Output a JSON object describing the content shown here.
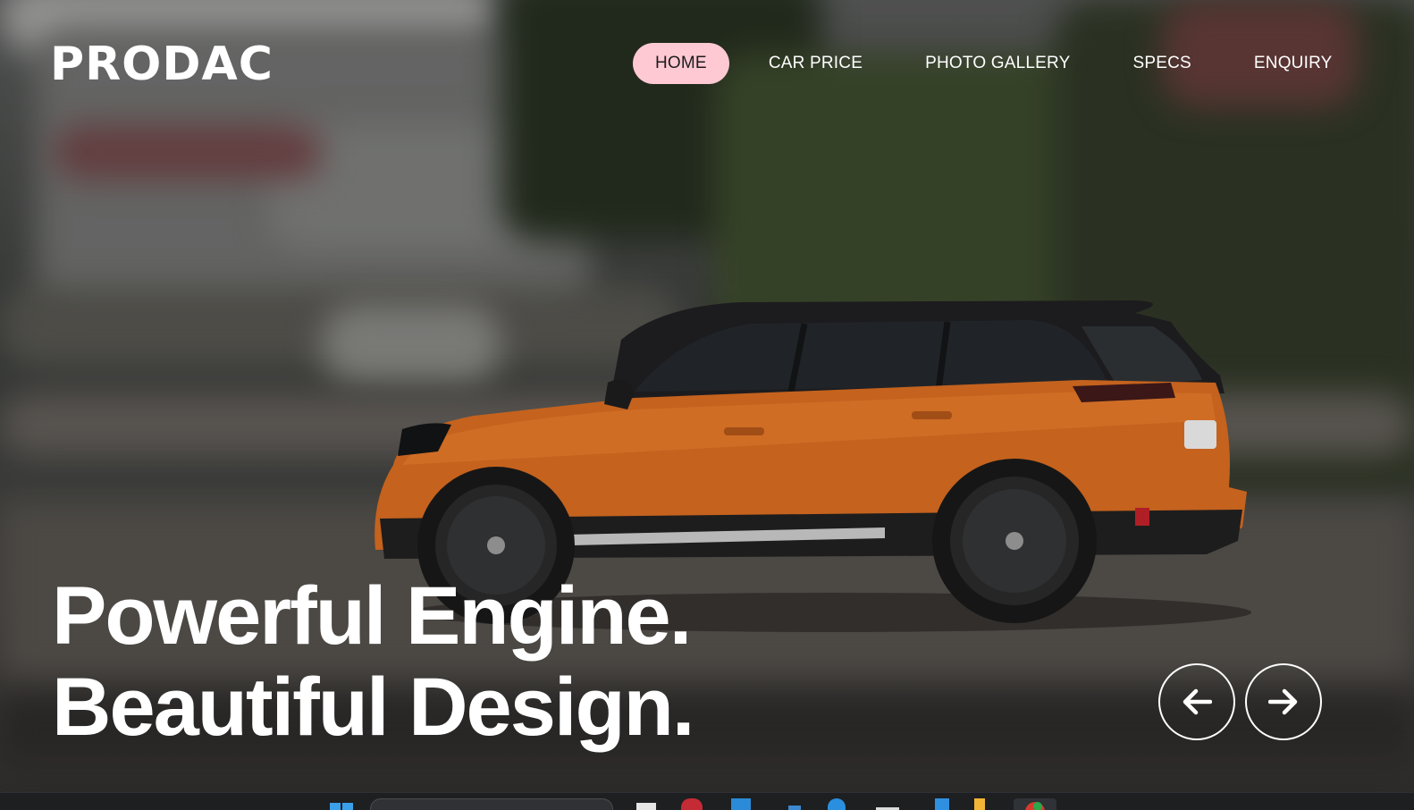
{
  "brand": {
    "logo": "PRODAC"
  },
  "nav": {
    "items": [
      {
        "label": "HOME",
        "active": true
      },
      {
        "label": "CAR PRICE",
        "active": false
      },
      {
        "label": "PHOTO GALLERY",
        "active": false
      },
      {
        "label": "SPECS",
        "active": false
      },
      {
        "label": "ENQUIRY",
        "active": false
      }
    ]
  },
  "hero": {
    "headline_line1": "Powerful Engine.",
    "headline_line2": "Beautiful Design.",
    "prev_icon": "arrow-left-icon",
    "next_icon": "arrow-right-icon"
  },
  "colors": {
    "active_nav_bg": "#ffc9d4",
    "text": "#ffffff",
    "car_body": "#c4621e",
    "taskbar": "#1d1f21"
  },
  "taskbar": {
    "icons": [
      "windows-start-icon",
      "search-box",
      "file-explorer-icon",
      "app-icon",
      "calendar-icon",
      "app-icon",
      "edge-icon",
      "app-icon",
      "vscode-icon",
      "folder-icon",
      "chrome-icon"
    ]
  }
}
